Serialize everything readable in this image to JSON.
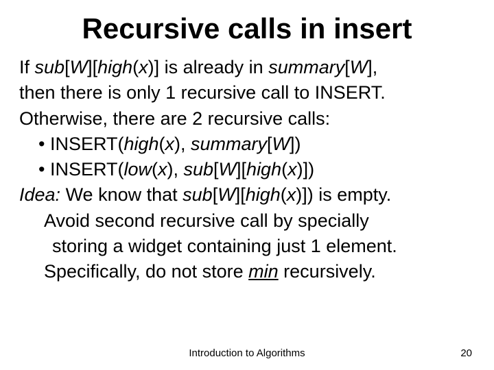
{
  "title": "Recursive calls in insert",
  "lines": {
    "l1a": "If ",
    "l1b": "sub",
    "l1c": "[",
    "l1d": "W",
    "l1e": "][",
    "l1f": "high",
    "l1g": "(",
    "l1h": "x",
    "l1i": ")] is already in ",
    "l1j": "summary",
    "l1k": "[",
    "l1l": "W",
    "l1m": "],",
    "l2": "then there is only 1 recursive call to INSERT.",
    "l3": "Otherwise, there are 2 recursive calls:",
    "l4a": "• INSERT(",
    "l4b": "high",
    "l4c": "(",
    "l4d": "x",
    "l4e": "), ",
    "l4f": "summary",
    "l4g": "[",
    "l4h": "W",
    "l4i": "])",
    "l5a": "• INSERT(",
    "l5b": "low",
    "l5c": "(",
    "l5d": "x",
    "l5e": "), ",
    "l5f": "sub",
    "l5g": "[",
    "l5h": "W",
    "l5i": "][",
    "l5j": "high",
    "l5k": "(",
    "l5l": "x",
    "l5m": ")])",
    "l6a": "Idea:",
    "l6b": " We know that ",
    "l6c": "sub",
    "l6d": "[",
    "l6e": "W",
    "l6f": "][",
    "l6g": "high",
    "l6h": "(",
    "l6i": "x",
    "l6j": ")]) is empty.",
    "l7": "Avoid second recursive call by specially",
    "l8": "storing a widget containing just 1 element.",
    "l9a": "Specifically, do not store ",
    "l9b": "min",
    "l9c": " recursively."
  },
  "footer_center": "Introduction to Algorithms",
  "footer_right": "20"
}
